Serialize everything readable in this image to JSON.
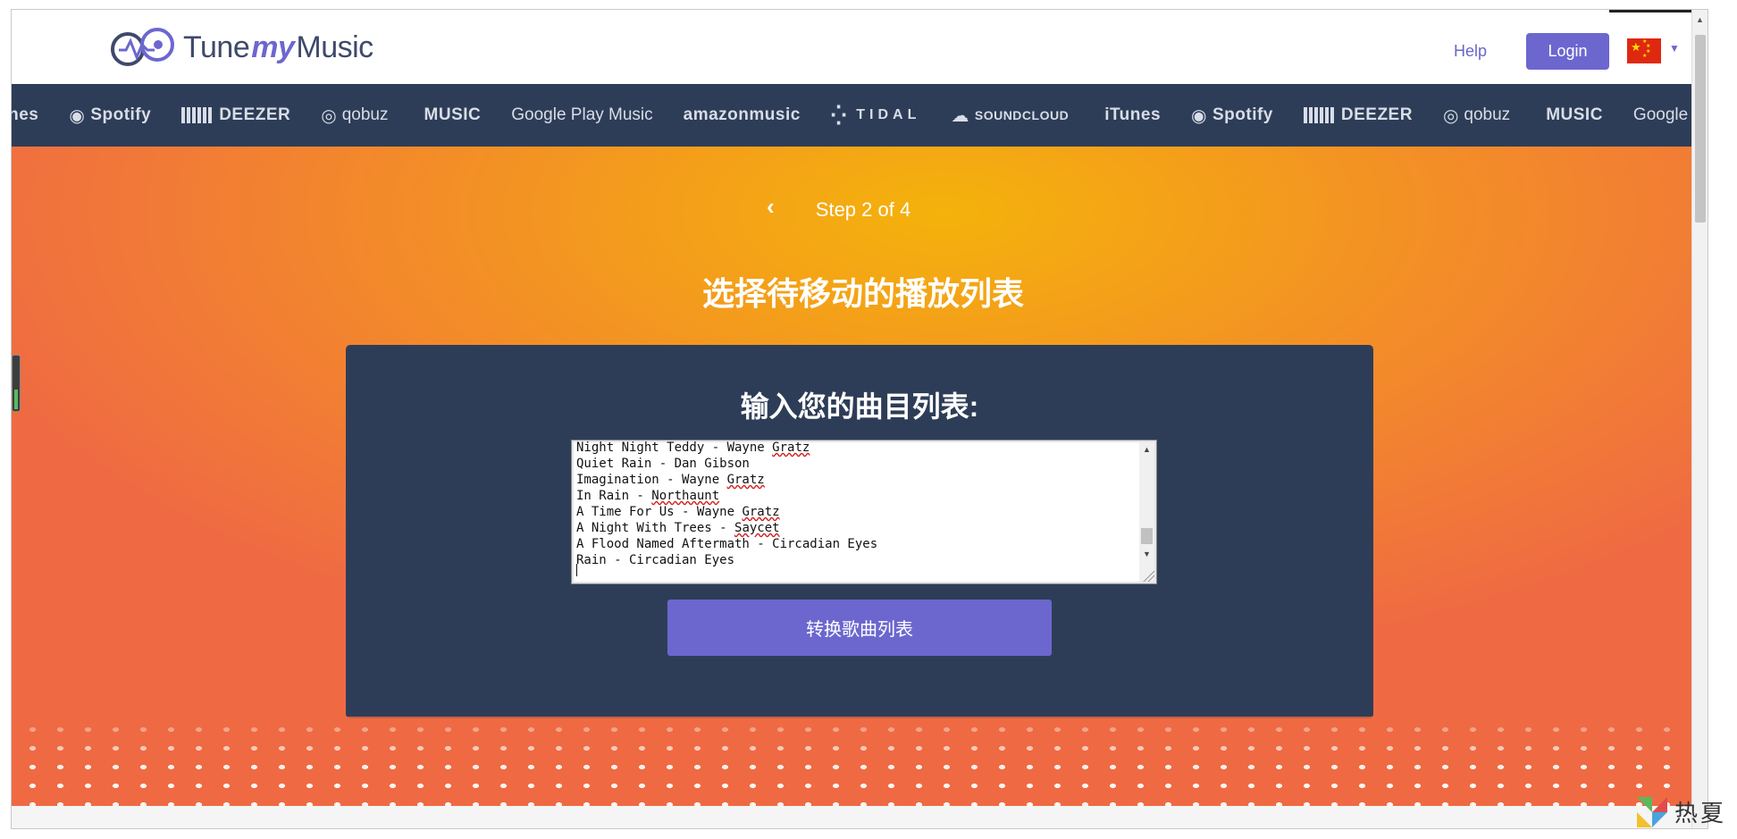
{
  "header": {
    "logo_part1": "Tune",
    "logo_part2": "my",
    "logo_part3": "Music",
    "help_label": "Help",
    "login_label": "Login",
    "language_flag": "cn-flag-icon"
  },
  "services": [
    "unes",
    "Spotify",
    "DEEZER",
    "qobuz",
    "MUSIC",
    "Google Play Music",
    "amazonmusic",
    "TIDAL",
    "SOUNDCLOUD",
    "iTunes",
    "Spotify",
    "DEEZER",
    "qobuz",
    "MUSIC",
    "Google Play"
  ],
  "step": {
    "text": "Step 2 of 4"
  },
  "hero": {
    "title": "选择待移动的播放列表"
  },
  "panel": {
    "title": "输入您的曲目列表:",
    "tracks": [
      "Night Night Teddy - Wayne Gratz",
      "Quiet Rain - Dan Gibson",
      "Imagination - Wayne Gratz",
      "In Rain - Northaunt",
      "A Time For Us - Wayne Gratz",
      "A Night With Trees - Saycet",
      "A Flood Named Aftermath - Circadian Eyes",
      "Rain - Circadian Eyes"
    ],
    "convert_label": "转换歌曲列表"
  },
  "watermark": {
    "text": "热夏"
  },
  "colors": {
    "brand": "#6c67cf",
    "navy": "#2e3d57",
    "orange_top": "#f4b20b",
    "orange_bottom": "#ef6a43"
  }
}
